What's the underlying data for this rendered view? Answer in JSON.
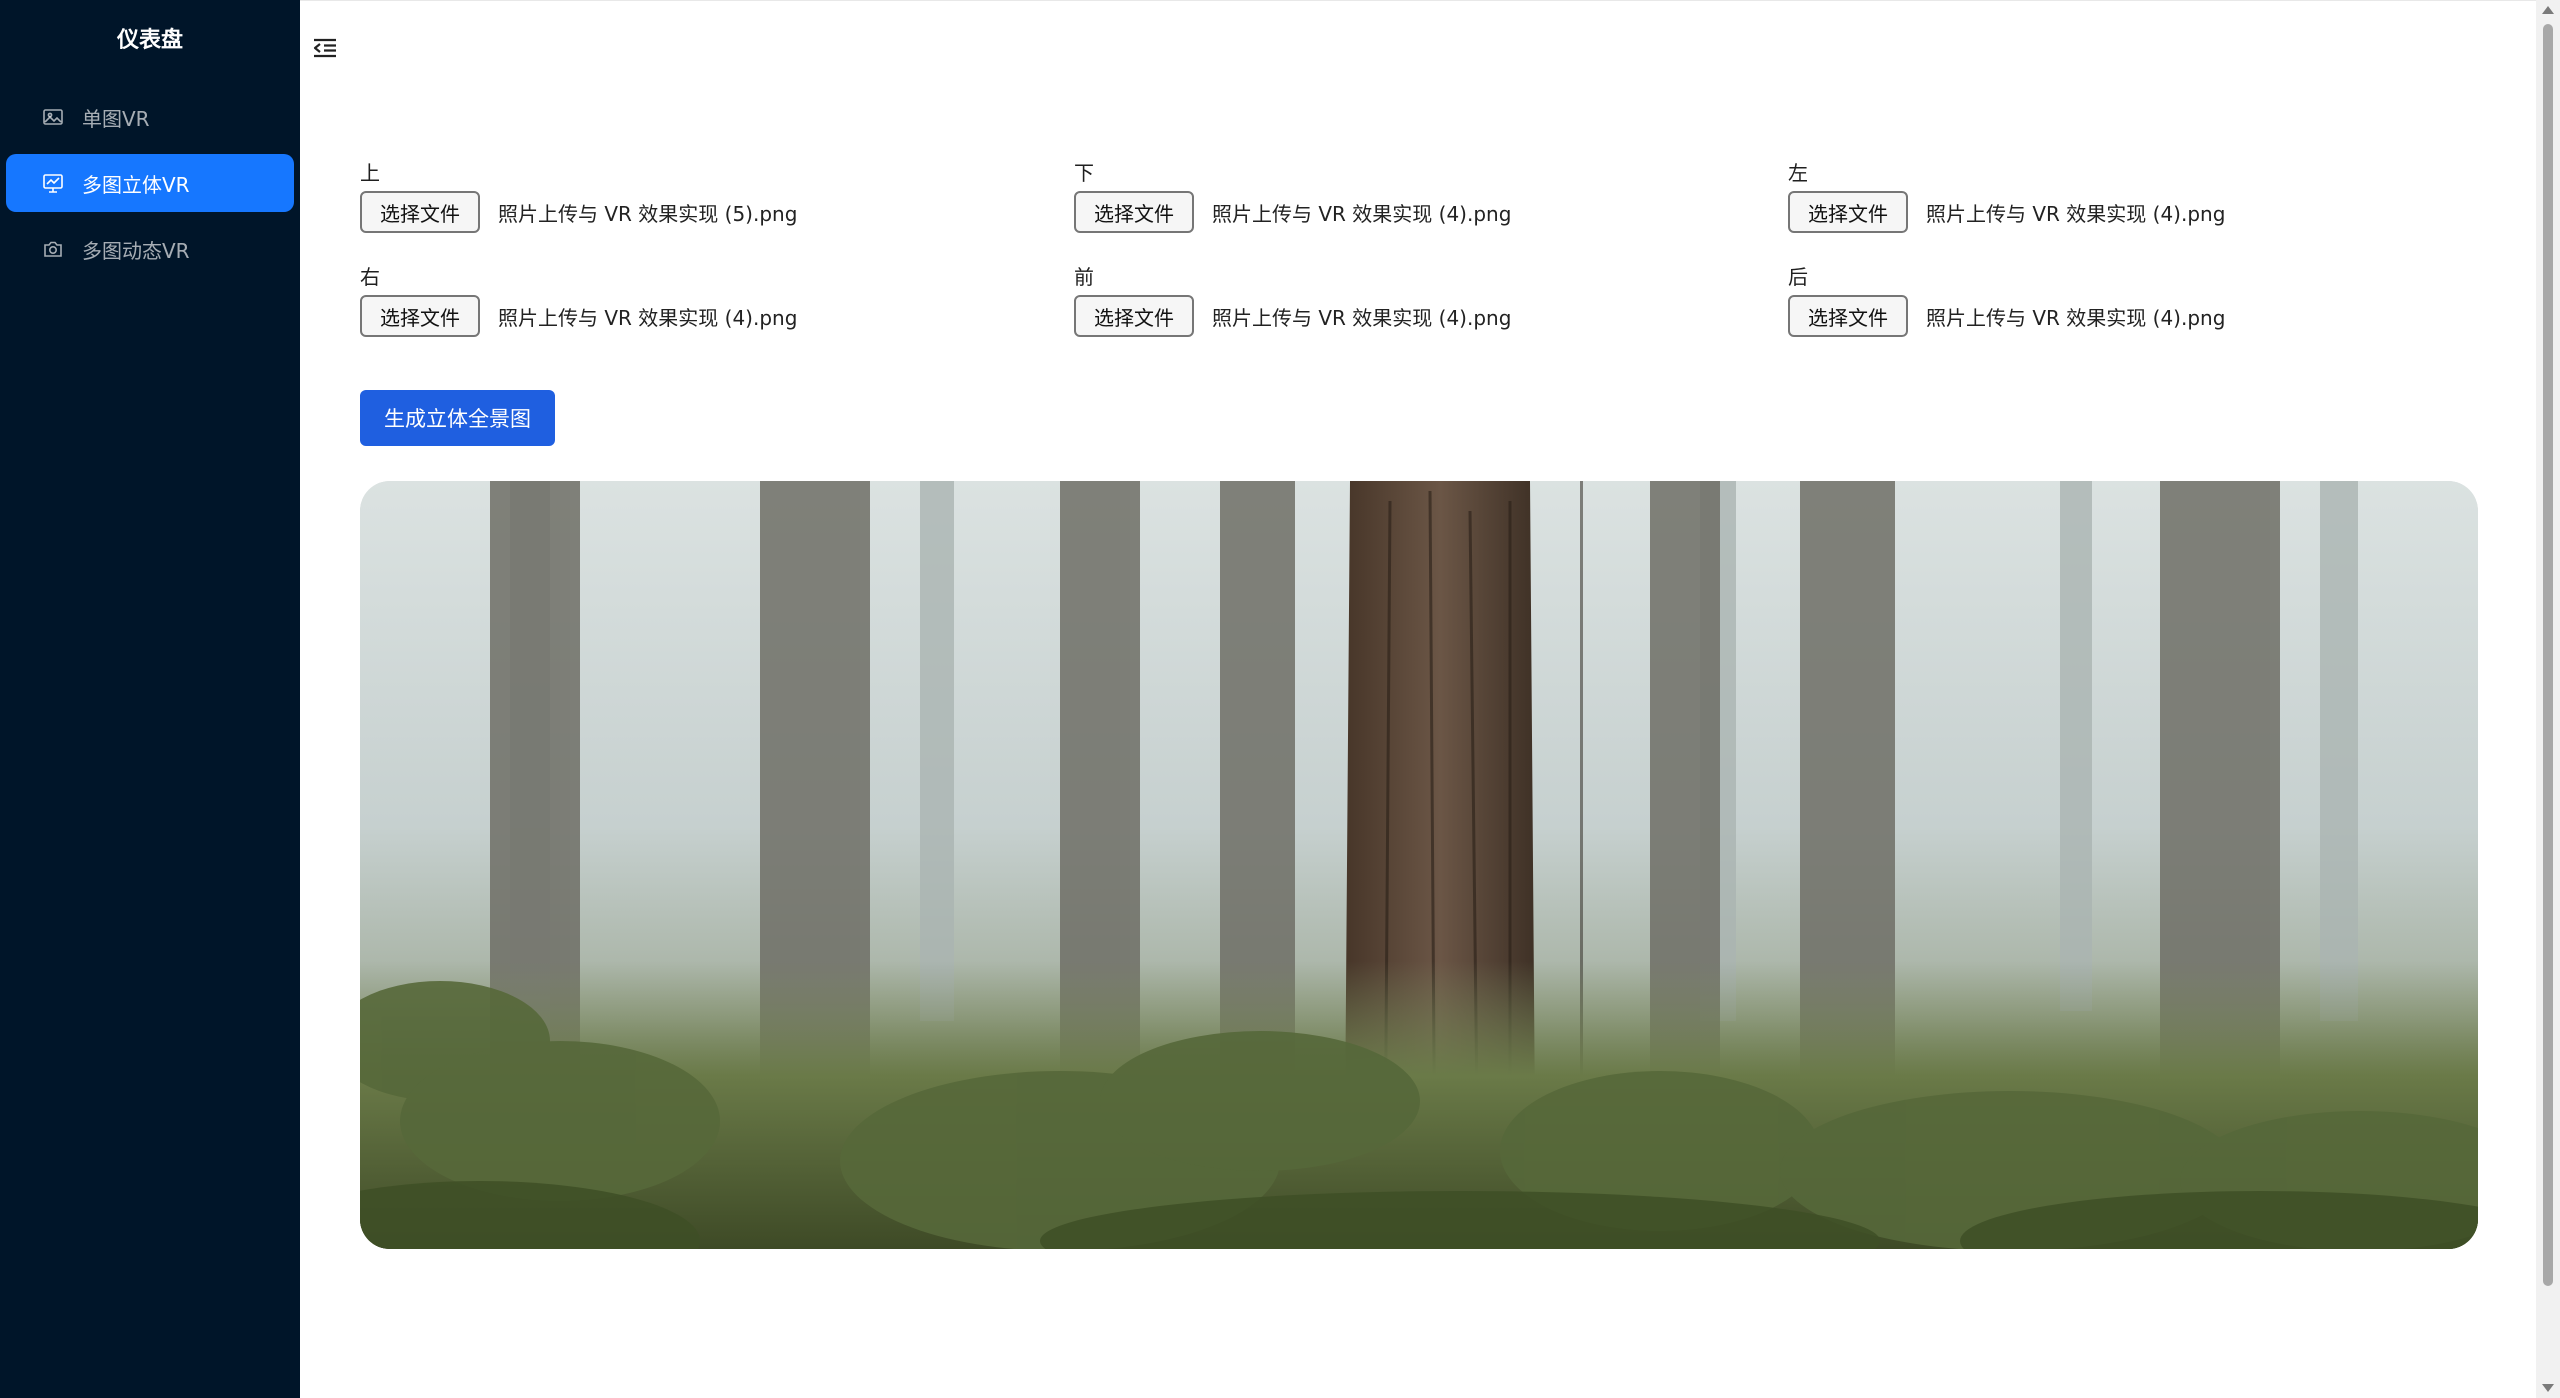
{
  "sidebar": {
    "brand": "仪表盘",
    "items": [
      {
        "label": "单图VR",
        "icon": "picture-icon",
        "active": false
      },
      {
        "label": "多图立体VR",
        "icon": "fund-projection-icon",
        "active": true
      },
      {
        "label": "多图动态VR",
        "icon": "camera-icon",
        "active": false
      }
    ]
  },
  "header": {
    "collapse_icon": "menu-fold-icon"
  },
  "uploads": [
    {
      "label": "上",
      "button": "选择文件",
      "file": "照片上传与 VR 效果实现 (5).png"
    },
    {
      "label": "下",
      "button": "选择文件",
      "file": "照片上传与 VR 效果实现 (4).png"
    },
    {
      "label": "左",
      "button": "选择文件",
      "file": "照片上传与 VR 效果实现 (4).png"
    },
    {
      "label": "右",
      "button": "选择文件",
      "file": "照片上传与 VR 效果实现 (4).png"
    },
    {
      "label": "前",
      "button": "选择文件",
      "file": "照片上传与 VR 效果实现 (4).png"
    },
    {
      "label": "后",
      "button": "选择文件",
      "file": "照片上传与 VR 效果实现 (4).png"
    }
  ],
  "generate_button": "生成立体全景图",
  "colors": {
    "sidebar_bg": "#001529",
    "active_item": "#1677ff",
    "primary_button": "#1f5fe0"
  }
}
